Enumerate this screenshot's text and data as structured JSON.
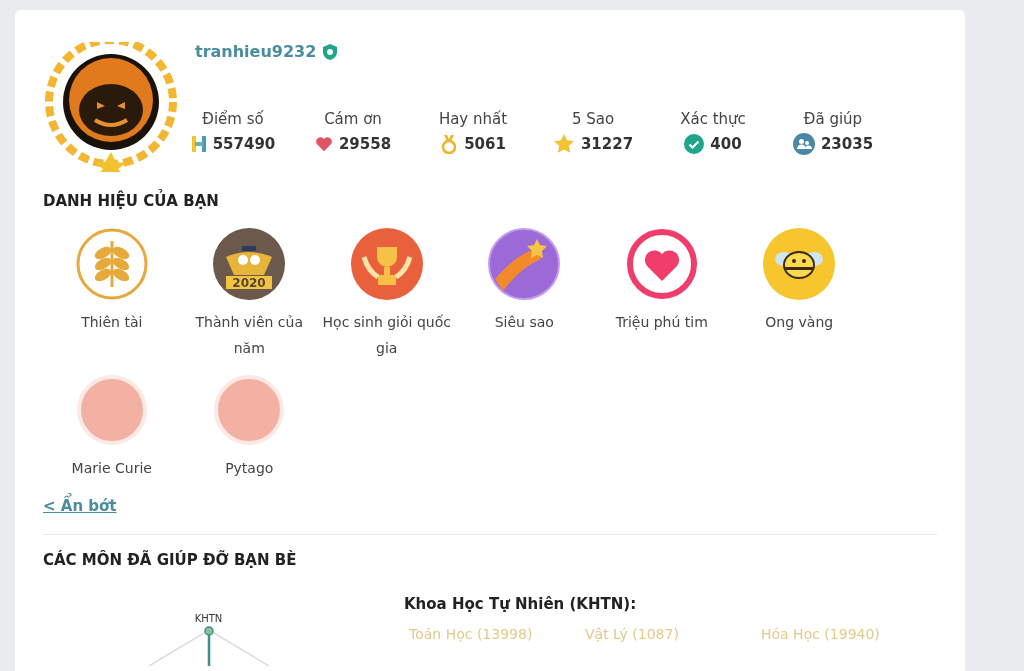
{
  "profile": {
    "username": "tranhieu9232",
    "verified": true
  },
  "stats": [
    {
      "label": "Điểm số",
      "value": "557490",
      "kind": "points"
    },
    {
      "label": "Cám ơn",
      "value": "29558",
      "kind": "heart"
    },
    {
      "label": "Hay nhất",
      "value": "5061",
      "kind": "medal"
    },
    {
      "label": "5 Sao",
      "value": "31227",
      "kind": "star"
    },
    {
      "label": "Xác thực",
      "value": "400",
      "kind": "check"
    },
    {
      "label": "Đã giúp",
      "value": "23035",
      "kind": "people"
    }
  ],
  "titles_section": {
    "heading": "DANH HIỆU CỦA BẠN",
    "collapse_link": "< Ẩn bớt",
    "badges": [
      {
        "name": "Thiên tài",
        "kind": "wheat"
      },
      {
        "name": "Thành viên của năm",
        "kind": "owl",
        "year": "2020"
      },
      {
        "name": "Học sinh giỏi quốc gia",
        "kind": "trophy"
      },
      {
        "name": "Siêu sao",
        "kind": "shooting-star"
      },
      {
        "name": "Triệu phú tim",
        "kind": "heart"
      },
      {
        "name": "Ong vàng",
        "kind": "bee"
      },
      {
        "name": "Marie Curie",
        "kind": "portrait"
      },
      {
        "name": "Pytago",
        "kind": "portrait"
      }
    ]
  },
  "subjects_section": {
    "heading": "CÁC MÔN ĐÃ GIÚP ĐỠ BẠN BÈ",
    "tree_root": "KHTN",
    "group_title": "Khoa Học Tự Nhiên (KHTN):",
    "subjects": [
      "Toán Học (13998)",
      "Vật Lý (1087)",
      "Hóa Học (19940)"
    ]
  }
}
